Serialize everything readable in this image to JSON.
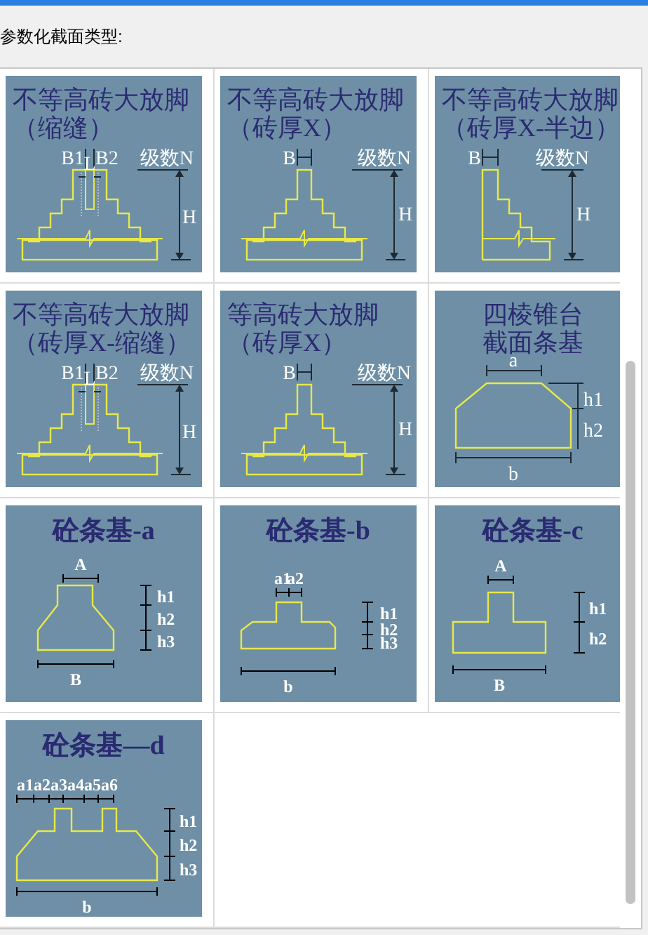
{
  "heading": "参数化截面类型:",
  "cells": [
    {
      "kind": "stepped-gap",
      "title": [
        "不等高砖大放脚",
        "（缩缝）"
      ],
      "labels": [
        "B1",
        "L",
        "B2",
        "级数N",
        "H"
      ]
    },
    {
      "kind": "stepped",
      "title": [
        "不等高砖大放脚",
        "（砖厚X）"
      ],
      "labels": [
        "B",
        "级数N",
        "H"
      ]
    },
    {
      "kind": "stepped-half",
      "title": [
        "不等高砖大放脚",
        "（砖厚X-半边）"
      ],
      "labels": [
        "B",
        "级数N",
        "H"
      ]
    },
    {
      "kind": "stepped-gap",
      "title": [
        "不等高砖大放脚",
        "（砖厚X-缩缝）"
      ],
      "labels": [
        "B1",
        "L",
        "B2",
        "级数N",
        "H"
      ]
    },
    {
      "kind": "stepped",
      "title": [
        "等高砖大放脚",
        "（砖厚X）"
      ],
      "labels": [
        "B",
        "级数N",
        "H"
      ]
    },
    {
      "kind": "frustum",
      "title": [
        "四棱锥台",
        "截面条基"
      ],
      "labels": [
        "a",
        "h1",
        "h2",
        "b"
      ]
    },
    {
      "kind": "concrete-a",
      "title": [
        "砼条基-a"
      ],
      "labels": [
        "A",
        "h1",
        "h2",
        "h3",
        "B"
      ]
    },
    {
      "kind": "concrete-b",
      "title": [
        "砼条基-b"
      ],
      "labels": [
        "a1",
        "a2",
        "h1",
        "h2",
        "h3",
        "b"
      ]
    },
    {
      "kind": "concrete-c",
      "title": [
        "砼条基-c"
      ],
      "labels": [
        "A",
        "h1",
        "h2",
        "B"
      ]
    },
    {
      "kind": "concrete-d",
      "title": [
        "砼条基—d"
      ],
      "labels": [
        "a1a2a3a4a5a6",
        "h1",
        "h2",
        "h3",
        "b"
      ]
    }
  ]
}
